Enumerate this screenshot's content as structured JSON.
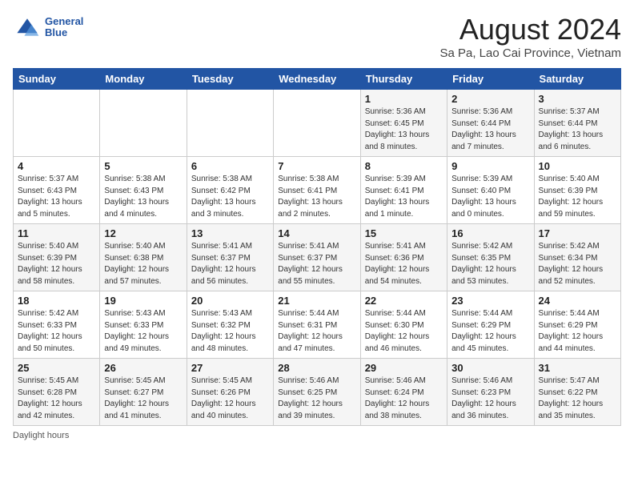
{
  "header": {
    "logo_line1": "General",
    "logo_line2": "Blue",
    "title": "August 2024",
    "subtitle": "Sa Pa, Lao Cai Province, Vietnam"
  },
  "columns": [
    "Sunday",
    "Monday",
    "Tuesday",
    "Wednesday",
    "Thursday",
    "Friday",
    "Saturday"
  ],
  "weeks": [
    [
      {
        "day": "",
        "info": ""
      },
      {
        "day": "",
        "info": ""
      },
      {
        "day": "",
        "info": ""
      },
      {
        "day": "",
        "info": ""
      },
      {
        "day": "1",
        "info": "Sunrise: 5:36 AM\nSunset: 6:45 PM\nDaylight: 13 hours\nand 8 minutes."
      },
      {
        "day": "2",
        "info": "Sunrise: 5:36 AM\nSunset: 6:44 PM\nDaylight: 13 hours\nand 7 minutes."
      },
      {
        "day": "3",
        "info": "Sunrise: 5:37 AM\nSunset: 6:44 PM\nDaylight: 13 hours\nand 6 minutes."
      }
    ],
    [
      {
        "day": "4",
        "info": "Sunrise: 5:37 AM\nSunset: 6:43 PM\nDaylight: 13 hours\nand 5 minutes."
      },
      {
        "day": "5",
        "info": "Sunrise: 5:38 AM\nSunset: 6:43 PM\nDaylight: 13 hours\nand 4 minutes."
      },
      {
        "day": "6",
        "info": "Sunrise: 5:38 AM\nSunset: 6:42 PM\nDaylight: 13 hours\nand 3 minutes."
      },
      {
        "day": "7",
        "info": "Sunrise: 5:38 AM\nSunset: 6:41 PM\nDaylight: 13 hours\nand 2 minutes."
      },
      {
        "day": "8",
        "info": "Sunrise: 5:39 AM\nSunset: 6:41 PM\nDaylight: 13 hours\nand 1 minute."
      },
      {
        "day": "9",
        "info": "Sunrise: 5:39 AM\nSunset: 6:40 PM\nDaylight: 13 hours\nand 0 minutes."
      },
      {
        "day": "10",
        "info": "Sunrise: 5:40 AM\nSunset: 6:39 PM\nDaylight: 12 hours\nand 59 minutes."
      }
    ],
    [
      {
        "day": "11",
        "info": "Sunrise: 5:40 AM\nSunset: 6:39 PM\nDaylight: 12 hours\nand 58 minutes."
      },
      {
        "day": "12",
        "info": "Sunrise: 5:40 AM\nSunset: 6:38 PM\nDaylight: 12 hours\nand 57 minutes."
      },
      {
        "day": "13",
        "info": "Sunrise: 5:41 AM\nSunset: 6:37 PM\nDaylight: 12 hours\nand 56 minutes."
      },
      {
        "day": "14",
        "info": "Sunrise: 5:41 AM\nSunset: 6:37 PM\nDaylight: 12 hours\nand 55 minutes."
      },
      {
        "day": "15",
        "info": "Sunrise: 5:41 AM\nSunset: 6:36 PM\nDaylight: 12 hours\nand 54 minutes."
      },
      {
        "day": "16",
        "info": "Sunrise: 5:42 AM\nSunset: 6:35 PM\nDaylight: 12 hours\nand 53 minutes."
      },
      {
        "day": "17",
        "info": "Sunrise: 5:42 AM\nSunset: 6:34 PM\nDaylight: 12 hours\nand 52 minutes."
      }
    ],
    [
      {
        "day": "18",
        "info": "Sunrise: 5:42 AM\nSunset: 6:33 PM\nDaylight: 12 hours\nand 50 minutes."
      },
      {
        "day": "19",
        "info": "Sunrise: 5:43 AM\nSunset: 6:33 PM\nDaylight: 12 hours\nand 49 minutes."
      },
      {
        "day": "20",
        "info": "Sunrise: 5:43 AM\nSunset: 6:32 PM\nDaylight: 12 hours\nand 48 minutes."
      },
      {
        "day": "21",
        "info": "Sunrise: 5:44 AM\nSunset: 6:31 PM\nDaylight: 12 hours\nand 47 minutes."
      },
      {
        "day": "22",
        "info": "Sunrise: 5:44 AM\nSunset: 6:30 PM\nDaylight: 12 hours\nand 46 minutes."
      },
      {
        "day": "23",
        "info": "Sunrise: 5:44 AM\nSunset: 6:29 PM\nDaylight: 12 hours\nand 45 minutes."
      },
      {
        "day": "24",
        "info": "Sunrise: 5:44 AM\nSunset: 6:29 PM\nDaylight: 12 hours\nand 44 minutes."
      }
    ],
    [
      {
        "day": "25",
        "info": "Sunrise: 5:45 AM\nSunset: 6:28 PM\nDaylight: 12 hours\nand 42 minutes."
      },
      {
        "day": "26",
        "info": "Sunrise: 5:45 AM\nSunset: 6:27 PM\nDaylight: 12 hours\nand 41 minutes."
      },
      {
        "day": "27",
        "info": "Sunrise: 5:45 AM\nSunset: 6:26 PM\nDaylight: 12 hours\nand 40 minutes."
      },
      {
        "day": "28",
        "info": "Sunrise: 5:46 AM\nSunset: 6:25 PM\nDaylight: 12 hours\nand 39 minutes."
      },
      {
        "day": "29",
        "info": "Sunrise: 5:46 AM\nSunset: 6:24 PM\nDaylight: 12 hours\nand 38 minutes."
      },
      {
        "day": "30",
        "info": "Sunrise: 5:46 AM\nSunset: 6:23 PM\nDaylight: 12 hours\nand 36 minutes."
      },
      {
        "day": "31",
        "info": "Sunrise: 5:47 AM\nSunset: 6:22 PM\nDaylight: 12 hours\nand 35 minutes."
      }
    ]
  ],
  "footer": "Daylight hours"
}
